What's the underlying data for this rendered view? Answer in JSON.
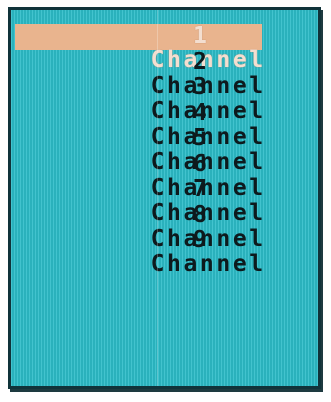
{
  "channel_menu": {
    "selected_index": 0,
    "items": [
      {
        "name": "Channel",
        "number": "1"
      },
      {
        "name": "Channel",
        "number": "2"
      },
      {
        "name": "Channel",
        "number": "3"
      },
      {
        "name": "Channel",
        "number": "4"
      },
      {
        "name": "Channel",
        "number": "5"
      },
      {
        "name": "Channel",
        "number": "6"
      },
      {
        "name": "Channel",
        "number": "7"
      },
      {
        "name": "Channel",
        "number": "8"
      },
      {
        "name": "Channel",
        "number": "9"
      }
    ]
  },
  "colors": {
    "panel_background": "#2dbcc8",
    "panel_border": "#10333a",
    "text": "#0d1a1d",
    "highlight_background": "#e9b48e",
    "highlight_text": "#f3ded0"
  }
}
